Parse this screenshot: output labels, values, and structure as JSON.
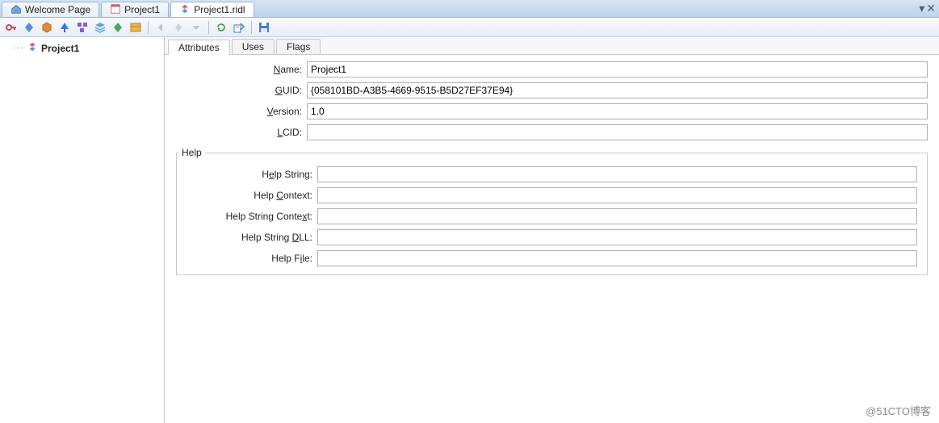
{
  "tabs": {
    "welcome": "Welcome Page",
    "project": "Project1",
    "ridl": "Project1.ridl",
    "active": "ridl"
  },
  "toolbar_icons": [
    "key-icon",
    "diamond-blue-icon",
    "cube-orange-icon",
    "tree-blue-icon",
    "blocks-purple-icon",
    "stack-icon",
    "diamond-green-icon",
    "module-icon",
    "sep",
    "arrow-left-icon",
    "diamond-gray-icon",
    "menu-icon",
    "sep",
    "refresh-icon",
    "export-icon",
    "sep",
    "save-icon"
  ],
  "tree": {
    "root": "Project1"
  },
  "inner_tabs": {
    "attributes": "Attributes",
    "uses": "Uses",
    "flags": "Flags",
    "active": "attributes"
  },
  "form": {
    "name_label": "Name:",
    "name_value": "Project1",
    "guid_label": "GUID:",
    "guid_value": "{058101BD-A3B5-4669-9515-B5D27EF37E94}",
    "version_label": "Version:",
    "version_value": "1.0",
    "lcid_label": "LCID:",
    "lcid_value": ""
  },
  "help": {
    "legend": "Help",
    "help_string_label": "Help String:",
    "help_string_value": "",
    "help_context_label": "Help Context:",
    "help_context_value": "",
    "help_string_context_label": "Help String Context:",
    "help_string_context_value": "",
    "help_string_dll_label": "Help String DLL:",
    "help_string_dll_value": "",
    "help_file_label": "Help File:",
    "help_file_value": ""
  },
  "watermark": "@51CTO博客"
}
